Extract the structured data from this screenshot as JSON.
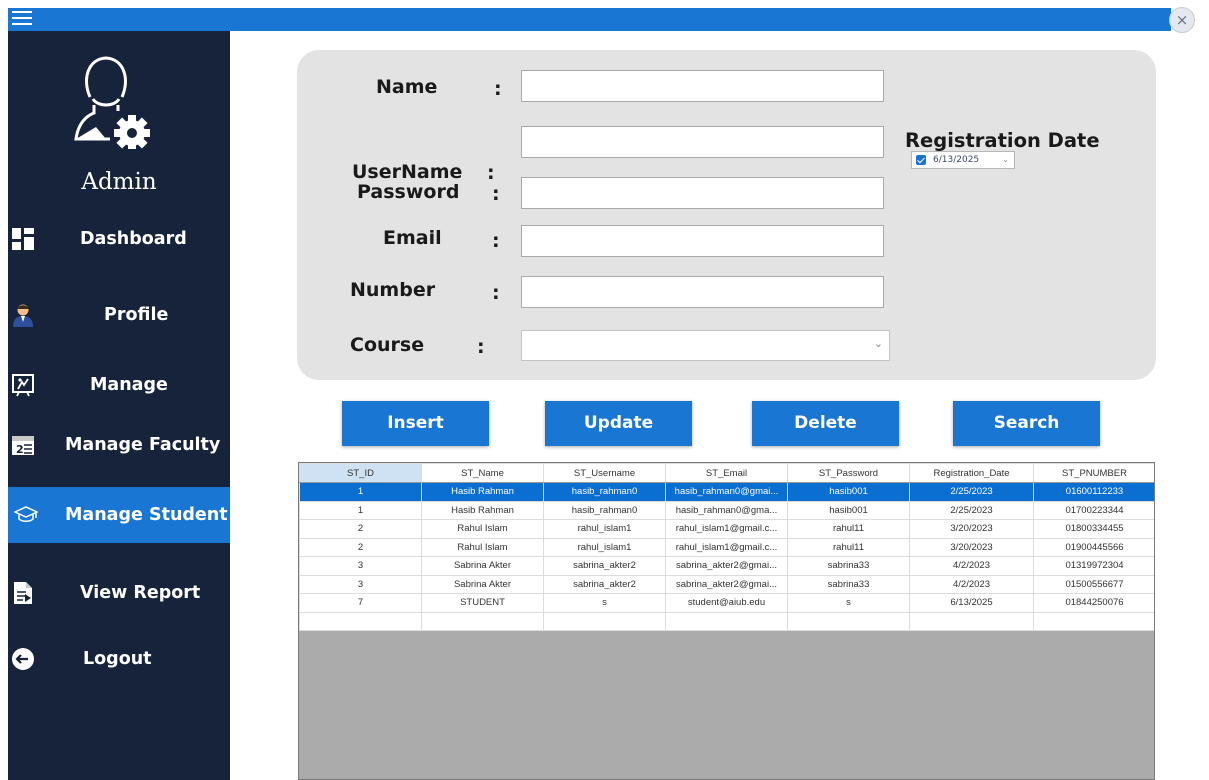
{
  "titlebar": {
    "menu_icon": "hamburger-icon",
    "close_icon": "close-icon",
    "close_glyph": "×"
  },
  "sidebar": {
    "admin_label": "Admin",
    "items": [
      {
        "label": "Dashboard",
        "icon": "dashboard-grid-icon"
      },
      {
        "label": "Profile",
        "icon": "user-profile-icon"
      },
      {
        "label": "Manage",
        "icon": "presentation-board-icon"
      },
      {
        "label": "Manage Faculty",
        "icon": "calendar-icon"
      },
      {
        "label": "Manage Student",
        "icon": "graduation-cap-icon",
        "active": true
      },
      {
        "label": "View Report",
        "icon": "document-report-icon"
      },
      {
        "label": "Logout",
        "icon": "logout-icon"
      }
    ]
  },
  "form": {
    "fields": [
      {
        "label": "Name",
        "value": ""
      },
      {
        "label": "UserName",
        "value": ""
      },
      {
        "label": "Password",
        "value": ""
      },
      {
        "label": "Email",
        "value": ""
      },
      {
        "label": "Number",
        "value": ""
      },
      {
        "label": "Course",
        "value": ""
      }
    ],
    "colon": ":",
    "registration_date_label": "Registration Date",
    "registration_date_value": "6/13/2025",
    "registration_date_checked": true
  },
  "buttons": {
    "insert": "Insert",
    "update": "Update",
    "delete": "Delete",
    "search": "Search"
  },
  "grid": {
    "columns": [
      "ST_ID",
      "ST_Name",
      "ST_Username",
      "ST_Email",
      "ST_Password",
      "Registration_Date",
      "ST_PNUMBER"
    ],
    "rows": [
      [
        "1",
        "Hasib Rahman",
        "hasib_rahman0",
        "hasib_rahman0@gmai...",
        "hasib001",
        "2/25/2023",
        "01600112233"
      ],
      [
        "1",
        "Hasib Rahman",
        "hasib_rahman0",
        "hasib_rahman0@gma...",
        "hasib001",
        "2/25/2023",
        "01700223344"
      ],
      [
        "2",
        "Rahul Islam",
        "rahul_islam1",
        "rahul_islam1@gmail.c...",
        "rahul11",
        "3/20/2023",
        "01800334455"
      ],
      [
        "2",
        "Rahul Islam",
        "rahul_islam1",
        "rahul_islam1@gmail.c...",
        "rahul11",
        "3/20/2023",
        "01900445566"
      ],
      [
        "3",
        "Sabrina Akter",
        "sabrina_akter2",
        "sabrina_akter2@gmai...",
        "sabrina33",
        "4/2/2023",
        "01319972304"
      ],
      [
        "3",
        "Sabrina Akter",
        "sabrina_akter2",
        "sabrina_akter2@gmai...",
        "sabrina33",
        "4/2/2023",
        "01500556677"
      ],
      [
        "7",
        "STUDENT",
        "s",
        "student@aiub.edu",
        "s",
        "6/13/2025",
        "01844250076"
      ]
    ],
    "selected_row": 0
  },
  "colors": {
    "accent": "#1976d2",
    "sidebar_bg": "#17233a",
    "panel_bg": "#e3e3e3",
    "selected_row": "#0a6fd1"
  }
}
